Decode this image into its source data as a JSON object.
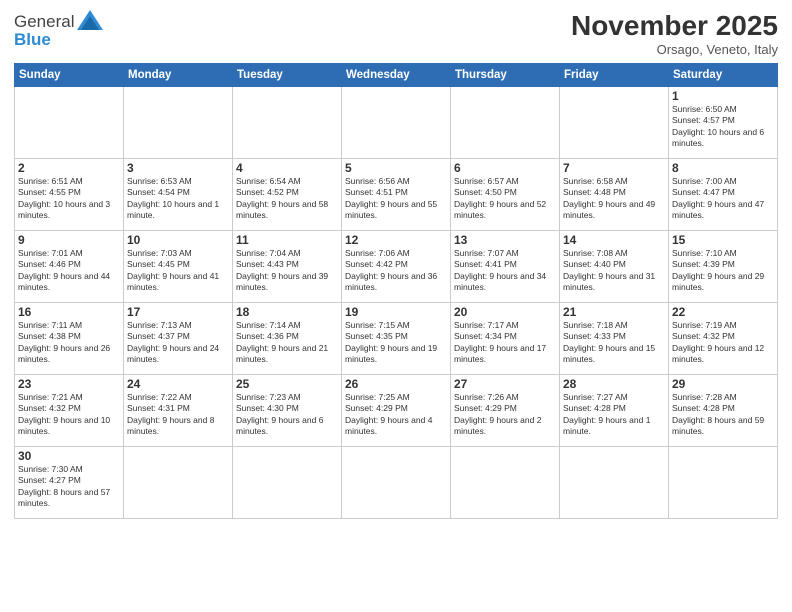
{
  "header": {
    "logo_general": "General",
    "logo_blue": "Blue",
    "month_title": "November 2025",
    "location": "Orsago, Veneto, Italy"
  },
  "weekdays": [
    "Sunday",
    "Monday",
    "Tuesday",
    "Wednesday",
    "Thursday",
    "Friday",
    "Saturday"
  ],
  "weeks": [
    [
      {
        "day": "",
        "info": ""
      },
      {
        "day": "",
        "info": ""
      },
      {
        "day": "",
        "info": ""
      },
      {
        "day": "",
        "info": ""
      },
      {
        "day": "",
        "info": ""
      },
      {
        "day": "",
        "info": ""
      },
      {
        "day": "1",
        "info": "Sunrise: 6:50 AM\nSunset: 4:57 PM\nDaylight: 10 hours and 6 minutes."
      }
    ],
    [
      {
        "day": "2",
        "info": "Sunrise: 6:51 AM\nSunset: 4:55 PM\nDaylight: 10 hours and 3 minutes."
      },
      {
        "day": "3",
        "info": "Sunrise: 6:53 AM\nSunset: 4:54 PM\nDaylight: 10 hours and 1 minute."
      },
      {
        "day": "4",
        "info": "Sunrise: 6:54 AM\nSunset: 4:52 PM\nDaylight: 9 hours and 58 minutes."
      },
      {
        "day": "5",
        "info": "Sunrise: 6:56 AM\nSunset: 4:51 PM\nDaylight: 9 hours and 55 minutes."
      },
      {
        "day": "6",
        "info": "Sunrise: 6:57 AM\nSunset: 4:50 PM\nDaylight: 9 hours and 52 minutes."
      },
      {
        "day": "7",
        "info": "Sunrise: 6:58 AM\nSunset: 4:48 PM\nDaylight: 9 hours and 49 minutes."
      },
      {
        "day": "8",
        "info": "Sunrise: 7:00 AM\nSunset: 4:47 PM\nDaylight: 9 hours and 47 minutes."
      }
    ],
    [
      {
        "day": "9",
        "info": "Sunrise: 7:01 AM\nSunset: 4:46 PM\nDaylight: 9 hours and 44 minutes."
      },
      {
        "day": "10",
        "info": "Sunrise: 7:03 AM\nSunset: 4:45 PM\nDaylight: 9 hours and 41 minutes."
      },
      {
        "day": "11",
        "info": "Sunrise: 7:04 AM\nSunset: 4:43 PM\nDaylight: 9 hours and 39 minutes."
      },
      {
        "day": "12",
        "info": "Sunrise: 7:06 AM\nSunset: 4:42 PM\nDaylight: 9 hours and 36 minutes."
      },
      {
        "day": "13",
        "info": "Sunrise: 7:07 AM\nSunset: 4:41 PM\nDaylight: 9 hours and 34 minutes."
      },
      {
        "day": "14",
        "info": "Sunrise: 7:08 AM\nSunset: 4:40 PM\nDaylight: 9 hours and 31 minutes."
      },
      {
        "day": "15",
        "info": "Sunrise: 7:10 AM\nSunset: 4:39 PM\nDaylight: 9 hours and 29 minutes."
      }
    ],
    [
      {
        "day": "16",
        "info": "Sunrise: 7:11 AM\nSunset: 4:38 PM\nDaylight: 9 hours and 26 minutes."
      },
      {
        "day": "17",
        "info": "Sunrise: 7:13 AM\nSunset: 4:37 PM\nDaylight: 9 hours and 24 minutes."
      },
      {
        "day": "18",
        "info": "Sunrise: 7:14 AM\nSunset: 4:36 PM\nDaylight: 9 hours and 21 minutes."
      },
      {
        "day": "19",
        "info": "Sunrise: 7:15 AM\nSunset: 4:35 PM\nDaylight: 9 hours and 19 minutes."
      },
      {
        "day": "20",
        "info": "Sunrise: 7:17 AM\nSunset: 4:34 PM\nDaylight: 9 hours and 17 minutes."
      },
      {
        "day": "21",
        "info": "Sunrise: 7:18 AM\nSunset: 4:33 PM\nDaylight: 9 hours and 15 minutes."
      },
      {
        "day": "22",
        "info": "Sunrise: 7:19 AM\nSunset: 4:32 PM\nDaylight: 9 hours and 12 minutes."
      }
    ],
    [
      {
        "day": "23",
        "info": "Sunrise: 7:21 AM\nSunset: 4:32 PM\nDaylight: 9 hours and 10 minutes."
      },
      {
        "day": "24",
        "info": "Sunrise: 7:22 AM\nSunset: 4:31 PM\nDaylight: 9 hours and 8 minutes."
      },
      {
        "day": "25",
        "info": "Sunrise: 7:23 AM\nSunset: 4:30 PM\nDaylight: 9 hours and 6 minutes."
      },
      {
        "day": "26",
        "info": "Sunrise: 7:25 AM\nSunset: 4:29 PM\nDaylight: 9 hours and 4 minutes."
      },
      {
        "day": "27",
        "info": "Sunrise: 7:26 AM\nSunset: 4:29 PM\nDaylight: 9 hours and 2 minutes."
      },
      {
        "day": "28",
        "info": "Sunrise: 7:27 AM\nSunset: 4:28 PM\nDaylight: 9 hours and 1 minute."
      },
      {
        "day": "29",
        "info": "Sunrise: 7:28 AM\nSunset: 4:28 PM\nDaylight: 8 hours and 59 minutes."
      }
    ],
    [
      {
        "day": "30",
        "info": "Sunrise: 7:30 AM\nSunset: 4:27 PM\nDaylight: 8 hours and 57 minutes."
      },
      {
        "day": "",
        "info": ""
      },
      {
        "day": "",
        "info": ""
      },
      {
        "day": "",
        "info": ""
      },
      {
        "day": "",
        "info": ""
      },
      {
        "day": "",
        "info": ""
      },
      {
        "day": "",
        "info": ""
      }
    ]
  ]
}
